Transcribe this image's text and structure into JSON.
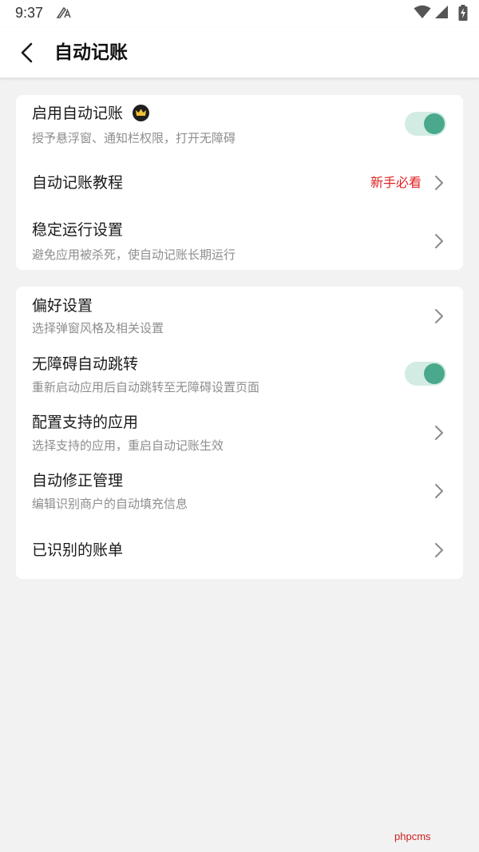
{
  "status_bar": {
    "time": "9:37"
  },
  "header": {
    "title": "自动记账"
  },
  "section1": {
    "items": [
      {
        "title": "启用自动记账",
        "subtitle": "授予悬浮窗、通知栏权限，打开无障碍",
        "toggle_on": true
      },
      {
        "title": "自动记账教程",
        "badge": "新手必看"
      },
      {
        "title": "稳定运行设置",
        "subtitle": "避免应用被杀死，使自动记账长期运行"
      }
    ]
  },
  "section2": {
    "items": [
      {
        "title": "偏好设置",
        "subtitle": "选择弹窗风格及相关设置"
      },
      {
        "title": "无障碍自动跳转",
        "subtitle": "重新启动应用后自动跳转至无障碍设置页面",
        "toggle_on": true
      },
      {
        "title": "配置支持的应用",
        "subtitle": "选择支持的应用，重启自动记账生效"
      },
      {
        "title": "自动修正管理",
        "subtitle": "编辑识别商户的自动填充信息"
      },
      {
        "title": "已识别的账单"
      }
    ]
  },
  "watermark": "phpcms",
  "colors": {
    "accent": "#4aa98c",
    "toggle_track": "#d3ece3",
    "badge": "#e02222",
    "background": "#f2f2f2"
  }
}
